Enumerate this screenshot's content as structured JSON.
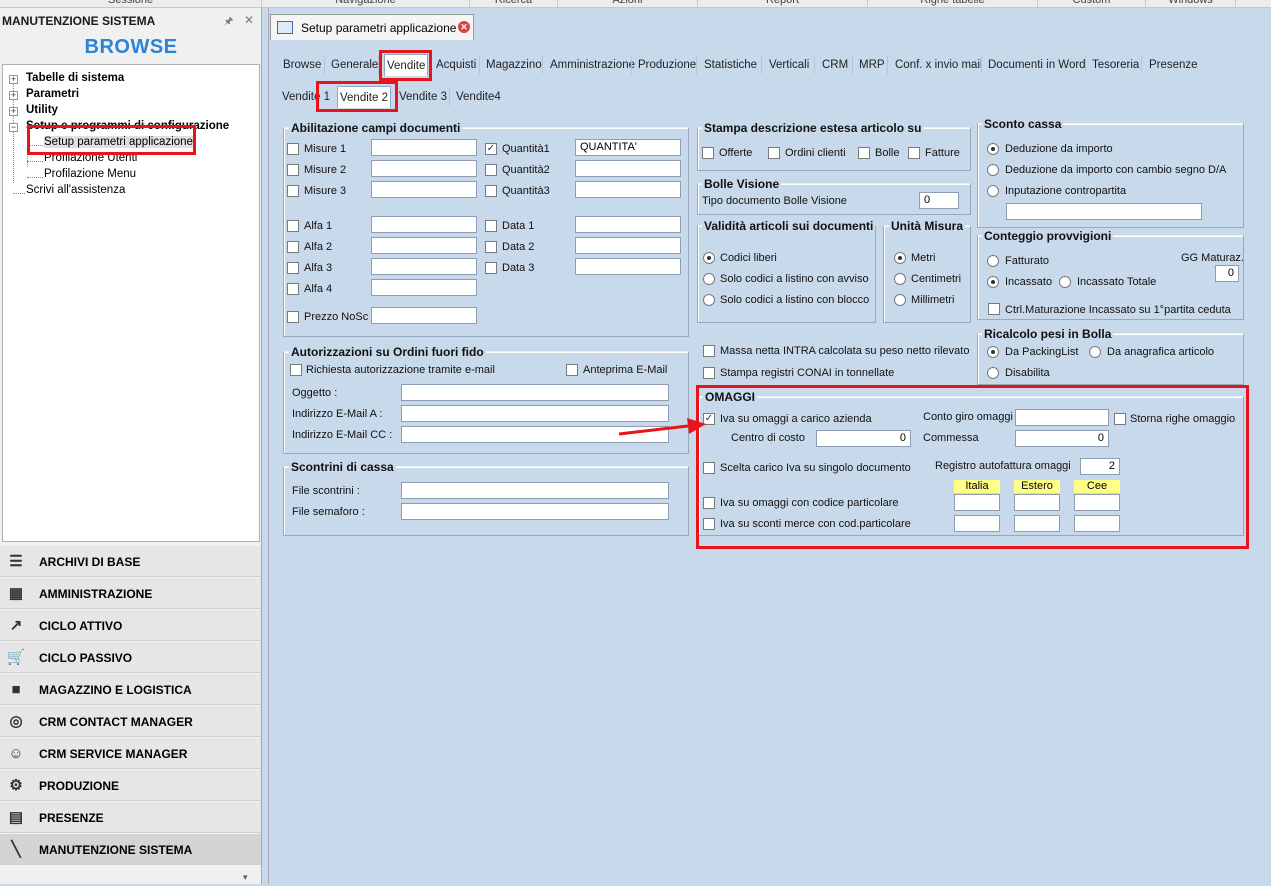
{
  "menubar": [
    "Sessione",
    "Navigazione",
    "Ricerca",
    "Azioni",
    "Report",
    "Righe tabelle",
    "Custom",
    "Windows"
  ],
  "left_panel": {
    "title": "MANUTENZIONE SISTEMA",
    "browse": "BROWSE",
    "tree": [
      "Tabelle di sistema",
      "Parametri",
      "Utility",
      "Setup e programmi di configurazione",
      "Setup parametri applicazione",
      "Profilazione Utenti",
      "Profilazione Menu",
      "Scrivi all'assistenza"
    ],
    "modules": [
      {
        "label": "ARCHIVI DI BASE",
        "icon": "archive-icon"
      },
      {
        "label": "AMMINISTRAZIONE",
        "icon": "calculator-icon"
      },
      {
        "label": "CICLO ATTIVO",
        "icon": "chart-up-icon"
      },
      {
        "label": "CICLO PASSIVO",
        "icon": "cart-icon"
      },
      {
        "label": "MAGAZZINO E LOGISTICA",
        "icon": "forklift-icon"
      },
      {
        "label": "CRM CONTACT MANAGER",
        "icon": "globe-icon"
      },
      {
        "label": "CRM SERVICE MANAGER",
        "icon": "people-icon"
      },
      {
        "label": "PRODUZIONE",
        "icon": "gear-icon"
      },
      {
        "label": "PRESENZE",
        "icon": "calendar-icon"
      },
      {
        "label": "MANUTENZIONE SISTEMA",
        "icon": "wrench-icon"
      }
    ]
  },
  "doc_tab": {
    "title": "Setup parametri applicazione"
  },
  "tabs": [
    "Browse",
    "Generale",
    "Vendite",
    "Acquisti",
    "Magazzino",
    "Amministrazione",
    "Produzione",
    "Statistiche",
    "Verticali",
    "CRM",
    "MRP",
    "Conf. x invio mail",
    "Documenti in Word",
    "Tesoreria",
    "Presenze"
  ],
  "subtabs": [
    "Vendite 1",
    "Vendite 2",
    "Vendite 3",
    "Vendite4"
  ],
  "abilitazione": {
    "title": "Abilitazione campi documenti",
    "left": [
      {
        "label": "Misure 1",
        "value": ""
      },
      {
        "label": "Misure 2",
        "value": ""
      },
      {
        "label": "Misure 3",
        "value": ""
      },
      {
        "label": "Alfa 1",
        "value": ""
      },
      {
        "label": "Alfa 2",
        "value": ""
      },
      {
        "label": "Alfa 3",
        "value": ""
      },
      {
        "label": "Alfa 4",
        "value": ""
      }
    ],
    "right": [
      {
        "label": "Quantità1",
        "value": "QUANTITA'"
      },
      {
        "label": "Quantità2",
        "value": ""
      },
      {
        "label": "Quantità3",
        "value": ""
      },
      {
        "label": "Data 1",
        "value": ""
      },
      {
        "label": "Data 2",
        "value": ""
      },
      {
        "label": "Data 3",
        "value": ""
      }
    ],
    "prezzo": "Prezzo NoSc"
  },
  "autorizzazioni": {
    "title": "Autorizzazioni su Ordini fuori fido",
    "richiesta": "Richiesta autorizzazione tramite e-mail",
    "anteprima": "Anteprima E-Mail",
    "oggetto": "Oggetto :",
    "email_a": "Indirizzo E-Mail  A :",
    "email_cc": "Indirizzo E-Mail CC :"
  },
  "scontrini": {
    "title": "Scontrini di cassa",
    "file": "File scontrini :",
    "semaforo": "File semaforo :"
  },
  "stampa": {
    "title": "Stampa descrizione estesa articolo su",
    "items": [
      "Offerte",
      "Ordini clienti",
      "Bolle",
      "Fatture"
    ]
  },
  "bolle": {
    "title": "Bolle Visione",
    "label": "Tipo documento Bolle Visione",
    "value": "0"
  },
  "validita": {
    "title": "Validità articoli sui documenti",
    "items": [
      "Codici liberi",
      "Solo codici a listino con avviso",
      "Solo codici a listino con blocco"
    ]
  },
  "unita": {
    "title": "Unità Misura",
    "items": [
      "Metri",
      "Centimetri",
      "Millimetri"
    ]
  },
  "sconto": {
    "title": "Sconto cassa",
    "items": [
      "Deduzione da importo",
      "Deduzione da importo con cambio segno D/A",
      "Inputazione contropartita"
    ]
  },
  "conteggio": {
    "title": "Conteggio provvigioni",
    "fatturato": "Fatturato",
    "incassato": "Incassato",
    "incassato_totale": "Incassato Totale",
    "gg_label": "GG Maturaz.",
    "gg_value": "0",
    "ctrl": "Ctrl.Maturazione Incassato su 1°partita ceduta"
  },
  "misc": {
    "massa": "Massa netta INTRA calcolata su peso netto rilevato",
    "conai": "Stampa registri CONAI in tonnellate"
  },
  "ricalcolo": {
    "title": "Ricalcolo pesi in Bolla",
    "packing": "Da PackingList",
    "anagrafica": "Da anagrafica articolo",
    "disabilita": "Disabilita"
  },
  "omaggi": {
    "title": "OMAGGI",
    "iva_carico": "Iva su omaggi a carico azienda",
    "centro": "Centro di costo",
    "centro_value": "0",
    "conto": "Conto giro omaggi",
    "storna": "Storna righe omaggio",
    "commessa": "Commessa",
    "commessa_value": "0",
    "scelta": "Scelta carico Iva su singolo documento",
    "registro": "Registro autofattura omaggi",
    "registro_value": "2",
    "hdr_italia": "Italia",
    "hdr_estero": "Estero",
    "hdr_cee": "Cee",
    "iva_codice": "Iva su omaggi con codice particolare",
    "iva_sconti": "Iva su sconti merce con cod.particolare"
  },
  "colors": {
    "highlight": "#e8141c",
    "browse": "#2a83d7",
    "panel": "#c9d9ec"
  }
}
